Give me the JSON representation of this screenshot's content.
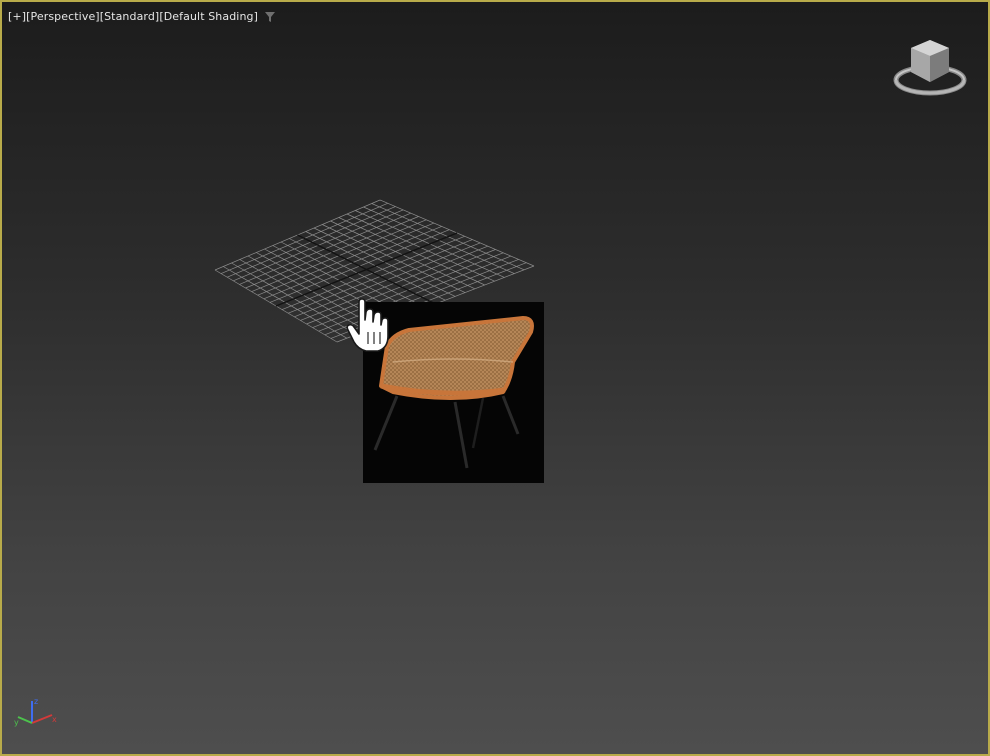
{
  "viewport": {
    "labels": [
      "[+]",
      "[Perspective]",
      "[Standard]",
      "[Default Shading]"
    ],
    "filter_icon": "funnel-icon",
    "border_color": "#b8ab4a",
    "viewcube_icon": "viewcube-icon",
    "grid": "home-grid",
    "cursor_icon": "hand-pointer-icon",
    "axis_tripod": {
      "x": "x",
      "y": "y",
      "z": "z"
    }
  },
  "drag_preview": {
    "icon": "lounge-chair-thumbnail",
    "colors": {
      "seat": "#b8895a",
      "rim": "#c8753a",
      "legs": "#2a2a2a"
    }
  }
}
